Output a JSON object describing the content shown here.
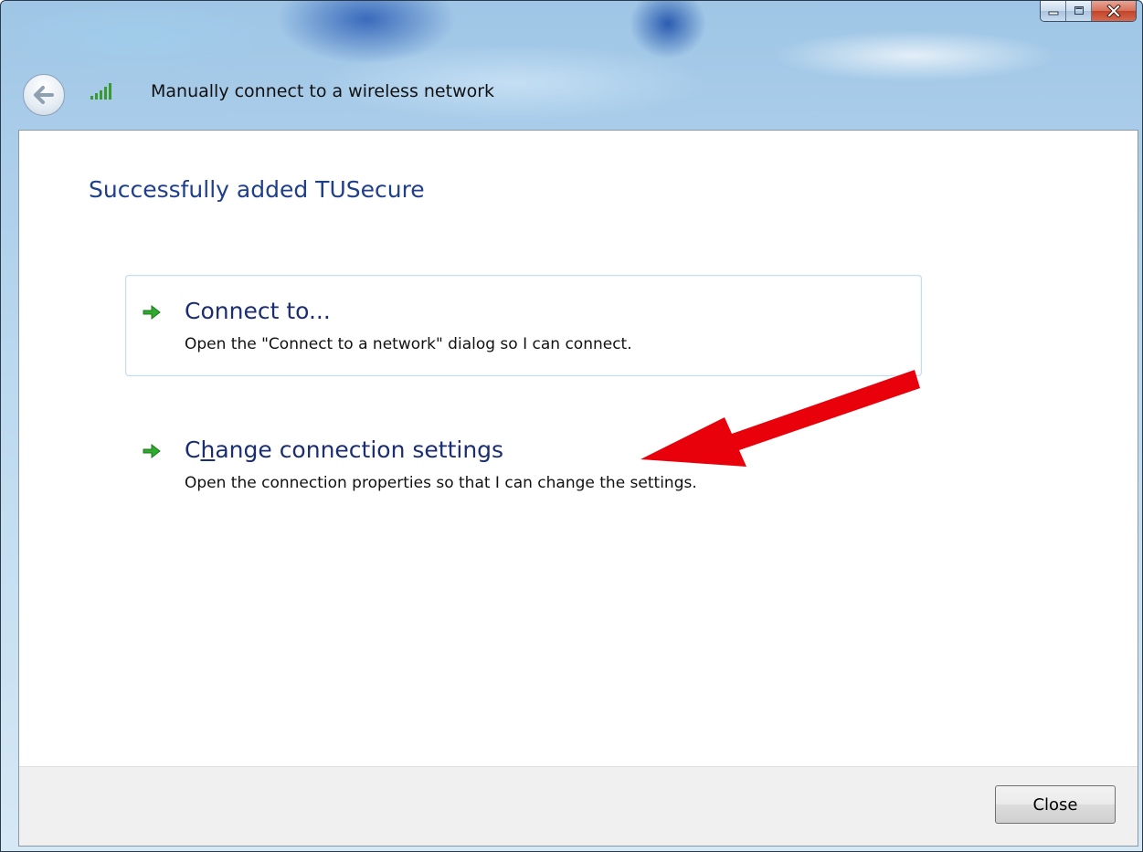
{
  "window": {
    "title": "Manually connect to a wireless network",
    "caption_buttons": {
      "minimize_icon": "minimize-icon",
      "maximize_icon": "maximize-icon",
      "close_icon": "close-x-icon"
    }
  },
  "nav": {
    "back_icon": "back-arrow-icon",
    "network_icon": "wireless-signal-icon"
  },
  "main": {
    "heading": "Successfully added TUSecure",
    "command_links": [
      {
        "title": "Connect to...",
        "description": "Open the \"Connect to a network\" dialog so I can connect.",
        "icon": "green-arrow-icon",
        "highlighted": true
      },
      {
        "title_prefix": "C",
        "title_mnemonic": "h",
        "title_suffix": "ange connection settings",
        "description": "Open the connection properties so that I can change the settings.",
        "icon": "green-arrow-icon",
        "highlighted": false
      }
    ],
    "annotation_arrow": {
      "icon": "red-annotation-arrow",
      "color": "#e8000b"
    }
  },
  "footer": {
    "close_label": "Close"
  },
  "colors": {
    "heading": "#1f3f8a",
    "link_title": "#1c2e72",
    "link_arrow": "#2eaa2e"
  }
}
